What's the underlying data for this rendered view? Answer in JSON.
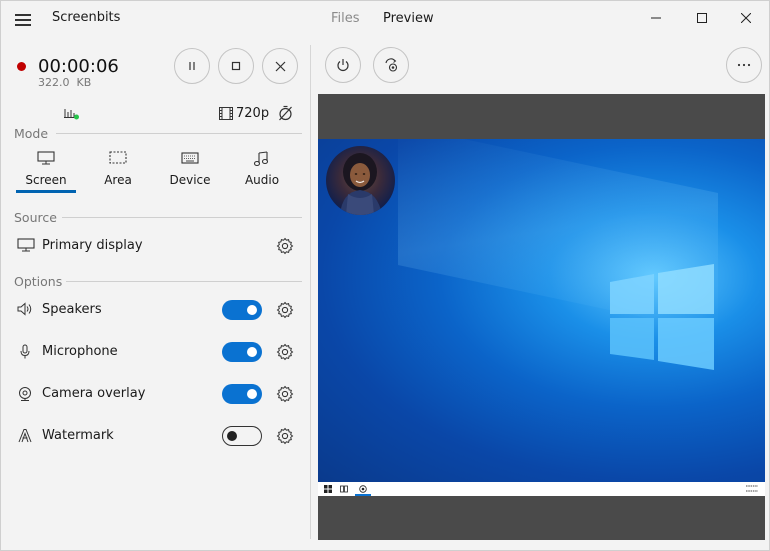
{
  "titlebar": {
    "app_title": "Screenbits",
    "tabs": [
      {
        "label": "Files",
        "active": false
      },
      {
        "label": "Preview",
        "active": true
      }
    ]
  },
  "recording": {
    "indicator_color": "#c00000",
    "elapsed": "00:00:06",
    "file_size": "322.0  KB"
  },
  "status": {
    "resolution": "720p"
  },
  "mode": {
    "title": "Mode",
    "selected": "Screen",
    "items": [
      {
        "label": "Screen",
        "icon": "monitor-icon"
      },
      {
        "label": "Area",
        "icon": "area-select-icon"
      },
      {
        "label": "Device",
        "icon": "keyboard-icon"
      },
      {
        "label": "Audio",
        "icon": "music-note-icon"
      }
    ]
  },
  "source": {
    "title": "Source",
    "label": "Primary display"
  },
  "options": {
    "title": "Options",
    "items": [
      {
        "label": "Speakers",
        "enabled": true
      },
      {
        "label": "Microphone",
        "enabled": true
      },
      {
        "label": "Camera overlay",
        "enabled": true
      },
      {
        "label": "Watermark",
        "enabled": false
      }
    ]
  },
  "colors": {
    "accent": "#0a72d1",
    "mode_underline": "#0063b1"
  }
}
